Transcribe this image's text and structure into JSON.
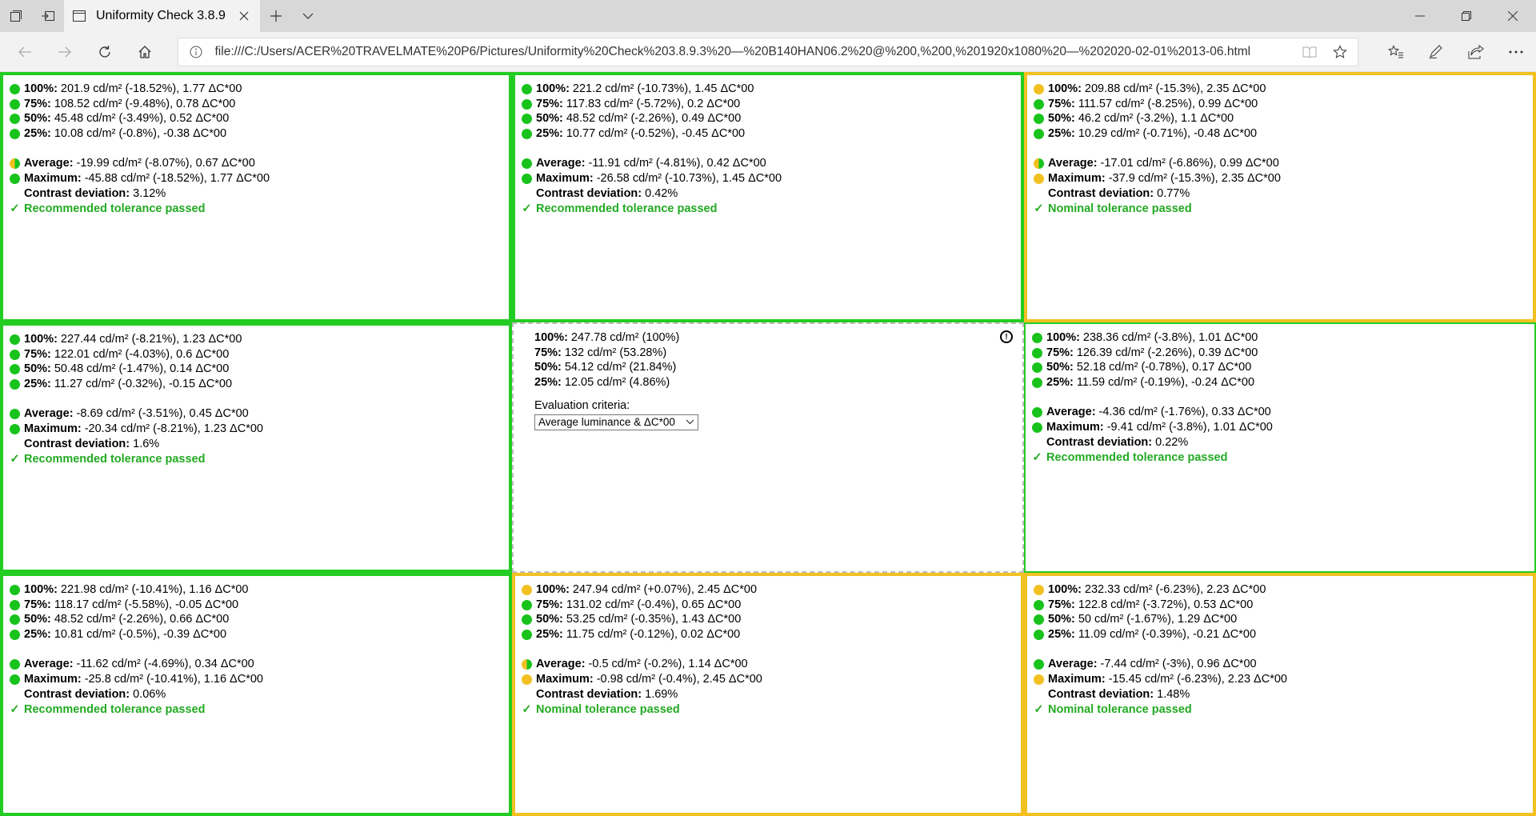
{
  "browser": {
    "tab_title": "Uniformity Check 3.8.9.3",
    "address": "file:///C:/Users/ACER%20TRAVELMATE%20P6/Pictures/Uniformity%20Check%203.8.9.3%20—%20B140HAN06.2%20@%200,%200,%201920x1080%20—%202020-02-01%2013-06.html"
  },
  "labels": {
    "l100": "100%:",
    "l75": "75%:",
    "l50": "50%:",
    "l25": "25%:",
    "average": "Average:",
    "maximum": "Maximum:",
    "contrast": "Contrast deviation:",
    "check": "✓"
  },
  "cells": [
    {
      "border": "green",
      "dots": [
        "green",
        "green",
        "green",
        "green",
        "half",
        "green"
      ],
      "v100": "201.9 cd/m² (-18.52%), 1.77 ΔC*00",
      "v75": "108.52 cd/m² (-9.48%), 0.78 ΔC*00",
      "v50": "45.48 cd/m² (-3.49%), 0.52 ΔC*00",
      "v25": "10.08 cd/m² (-0.8%), -0.38 ΔC*00",
      "average": "-19.99 cd/m² (-8.07%), 0.67 ΔC*00",
      "maximum": "-45.88 cd/m² (-18.52%), 1.77 ΔC*00",
      "contrast": "3.12%",
      "result": "Recommended tolerance passed"
    },
    {
      "border": "green",
      "dots": [
        "green",
        "green",
        "green",
        "green",
        "green",
        "green"
      ],
      "v100": "221.2 cd/m² (-10.73%), 1.45 ΔC*00",
      "v75": "117.83 cd/m² (-5.72%), 0.2 ΔC*00",
      "v50": "48.52 cd/m² (-2.26%), 0.49 ΔC*00",
      "v25": "10.77 cd/m² (-0.52%), -0.45 ΔC*00",
      "average": "-11.91 cd/m² (-4.81%), 0.42 ΔC*00",
      "maximum": "-26.58 cd/m² (-10.73%), 1.45 ΔC*00",
      "contrast": "0.42%",
      "result": "Recommended tolerance passed"
    },
    {
      "border": "yellow",
      "dots": [
        "yellow",
        "green",
        "green",
        "green",
        "half",
        "yellow"
      ],
      "v100": "209.88 cd/m² (-15.3%), 2.35 ΔC*00",
      "v75": "111.57 cd/m² (-8.25%), 0.99 ΔC*00",
      "v50": "46.2 cd/m² (-3.2%), 1.1 ΔC*00",
      "v25": "10.29 cd/m² (-0.71%), -0.48 ΔC*00",
      "average": "-17.01 cd/m² (-6.86%), 0.99 ΔC*00",
      "maximum": "-37.9 cd/m² (-15.3%), 2.35 ΔC*00",
      "contrast": "0.77%",
      "result": "Nominal tolerance passed"
    },
    {
      "border": "green",
      "dots": [
        "green",
        "green",
        "green",
        "green",
        "green",
        "green"
      ],
      "v100": "227.44 cd/m² (-8.21%), 1.23 ΔC*00",
      "v75": "122.01 cd/m² (-4.03%), 0.6 ΔC*00",
      "v50": "50.48 cd/m² (-1.47%), 0.14 ΔC*00",
      "v25": "11.27 cd/m² (-0.32%), -0.15 ΔC*00",
      "average": "-8.69 cd/m² (-3.51%), 0.45 ΔC*00",
      "maximum": "-20.34 cd/m² (-8.21%), 1.23 ΔC*00",
      "contrast": "1.6%",
      "result": "Recommended tolerance passed"
    },
    {
      "border": "center",
      "v100": "247.78 cd/m² (100%)",
      "v75": "132 cd/m² (53.28%)",
      "v50": "54.12 cd/m² (21.84%)",
      "v25": "12.05 cd/m² (4.86%)",
      "eval_label": "Evaluation criteria:",
      "eval_value": "Average luminance & ΔC*00"
    },
    {
      "border": "green",
      "dots": [
        "green",
        "green",
        "green",
        "green",
        "green",
        "green"
      ],
      "v100": "238.36 cd/m² (-3.8%), 1.01 ΔC*00",
      "v75": "126.39 cd/m² (-2.26%), 0.39 ΔC*00",
      "v50": "52.18 cd/m² (-0.78%), 0.17 ΔC*00",
      "v25": "11.59 cd/m² (-0.19%), -0.24 ΔC*00",
      "average": "-4.36 cd/m² (-1.76%), 0.33 ΔC*00",
      "maximum": "-9.41 cd/m² (-3.8%), 1.01 ΔC*00",
      "contrast": "0.22%",
      "result": "Recommended tolerance passed"
    },
    {
      "border": "green",
      "dots": [
        "green",
        "green",
        "green",
        "green",
        "green",
        "green"
      ],
      "v100": "221.98 cd/m² (-10.41%), 1.16 ΔC*00",
      "v75": "118.17 cd/m² (-5.58%), -0.05 ΔC*00",
      "v50": "48.52 cd/m² (-2.26%), 0.66 ΔC*00",
      "v25": "10.81 cd/m² (-0.5%), -0.39 ΔC*00",
      "average": "-11.62 cd/m² (-4.69%), 0.34 ΔC*00",
      "maximum": "-25.8 cd/m² (-10.41%), 1.16 ΔC*00",
      "contrast": "0.06%",
      "result": "Recommended tolerance passed"
    },
    {
      "border": "yellow",
      "dots": [
        "yellow",
        "green",
        "green",
        "green",
        "half",
        "yellow"
      ],
      "v100": "247.94 cd/m² (+0.07%), 2.45 ΔC*00",
      "v75": "131.02 cd/m² (-0.4%), 0.65 ΔC*00",
      "v50": "53.25 cd/m² (-0.35%), 1.43 ΔC*00",
      "v25": "11.75 cd/m² (-0.12%), 0.02 ΔC*00",
      "average": "-0.5 cd/m² (-0.2%), 1.14 ΔC*00",
      "maximum": "-0.98 cd/m² (-0.4%), 2.45 ΔC*00",
      "contrast": "1.69%",
      "result": "Nominal tolerance passed"
    },
    {
      "border": "yellow",
      "dots": [
        "yellow",
        "green",
        "green",
        "green",
        "green",
        "yellow"
      ],
      "v100": "232.33 cd/m² (-6.23%), 2.23 ΔC*00",
      "v75": "122.8 cd/m² (-3.72%), 0.53 ΔC*00",
      "v50": "50 cd/m² (-1.67%), 1.29 ΔC*00",
      "v25": "11.09 cd/m² (-0.39%), -0.21 ΔC*00",
      "average": "-7.44 cd/m² (-3%), 0.96 ΔC*00",
      "maximum": "-15.45 cd/m² (-6.23%), 2.23 ΔC*00",
      "contrast": "1.48%",
      "result": "Nominal tolerance passed"
    }
  ]
}
